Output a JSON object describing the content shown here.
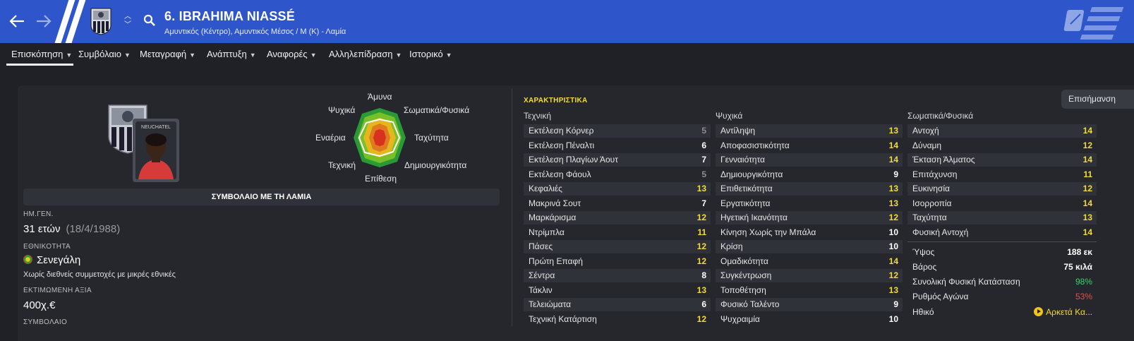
{
  "header": {
    "player_name": "6. IBRAHIMA NIASSÉ",
    "player_subtitle": "Αμυντικός (Κέντρο), Αμυντικός Μέσος / Μ (Κ) - Λαμία"
  },
  "tabs": [
    {
      "label": "Επισκόπηση"
    },
    {
      "label": "Συμβόλαιο"
    },
    {
      "label": "Μεταγραφή"
    },
    {
      "label": "Ανάπτυξη"
    },
    {
      "label": "Αναφορές"
    },
    {
      "label": "Αλληλεπίδραση"
    },
    {
      "label": "Ιστορικό"
    }
  ],
  "card": {
    "kit_text": "NEUCHATEL"
  },
  "radar": {
    "labels": {
      "top": "Άμυνα",
      "top_right": "Σωματικά/Φυσικά",
      "right": "Ταχύτητα",
      "bottom_right": "Δημιουργικότητα",
      "bottom": "Επίθεση",
      "bottom_left": "Τεχνική",
      "left": "Εναέρια",
      "top_left": "Ψυχικά"
    }
  },
  "contract": {
    "title": "ΣΥΜΒΟΛΑΙΟ ΜΕ ΤΗ ΛΑΜΙΑ"
  },
  "profile": {
    "dob_label": "ΗΜ.ΓΕΝ.",
    "age": "31 ετών",
    "dob": "(18/4/1988)",
    "nationality_label": "ΕΘΝΙΚΟΤΗΤΑ",
    "nationality": "Σενεγάλη",
    "caps_note": "Χωρίς διεθνείς συμμετοχές με μικρές εθνικές",
    "value_label": "ΕΚΤΙΜΩΜΕΝΗ ΑΞΙΑ",
    "value": "400χ.€",
    "contract_label": "ΣΥΜΒΟΛΑΙΟ"
  },
  "attributes": {
    "title": "ΧΑΡΑΚΤΗΡΙΣΤΙΚΑ",
    "emphasis_button": "Επισήμανση",
    "technical": {
      "heading": "Τεχνική",
      "rows": [
        {
          "name": "Εκτέλεση Κόρνερ",
          "value": "5"
        },
        {
          "name": "Εκτέλεση Πέναλτι",
          "value": "6"
        },
        {
          "name": "Εκτέλεση Πλαγίων Άουτ",
          "value": "7"
        },
        {
          "name": "Εκτέλεση Φάουλ",
          "value": "5"
        },
        {
          "name": "Κεφαλιές",
          "value": "13"
        },
        {
          "name": "Μακρινά Σουτ",
          "value": "7"
        },
        {
          "name": "Μαρκάρισμα",
          "value": "12"
        },
        {
          "name": "Ντρίμπλα",
          "value": "11"
        },
        {
          "name": "Πάσες",
          "value": "12"
        },
        {
          "name": "Πρώτη Επαφή",
          "value": "12"
        },
        {
          "name": "Σέντρα",
          "value": "8"
        },
        {
          "name": "Τάκλιν",
          "value": "13"
        },
        {
          "name": "Τελειώματα",
          "value": "6"
        },
        {
          "name": "Τεχνική Κατάρτιση",
          "value": "12"
        }
      ]
    },
    "mental": {
      "heading": "Ψυχικά",
      "rows": [
        {
          "name": "Αντίληψη",
          "value": "13"
        },
        {
          "name": "Αποφασιστικότητα",
          "value": "14"
        },
        {
          "name": "Γενναιότητα",
          "value": "14"
        },
        {
          "name": "Δημιουργικότητα",
          "value": "9"
        },
        {
          "name": "Επιθετικότητα",
          "value": "13"
        },
        {
          "name": "Εργατικότητα",
          "value": "13"
        },
        {
          "name": "Ηγετική Ικανότητα",
          "value": "12"
        },
        {
          "name": "Κίνηση Χωρίς την Μπάλα",
          "value": "10"
        },
        {
          "name": "Κρίση",
          "value": "10"
        },
        {
          "name": "Ομαδικότητα",
          "value": "14"
        },
        {
          "name": "Συγκέντρωση",
          "value": "12"
        },
        {
          "name": "Τοποθέτηση",
          "value": "13"
        },
        {
          "name": "Φυσικό Ταλέντο",
          "value": "9"
        },
        {
          "name": "Ψυχραιμία",
          "value": "10"
        }
      ]
    },
    "physical": {
      "heading": "Σωματικά/Φυσικά",
      "rows": [
        {
          "name": "Αντοχή",
          "value": "14"
        },
        {
          "name": "Δύναμη",
          "value": "12"
        },
        {
          "name": "Έκταση Άλματος",
          "value": "14"
        },
        {
          "name": "Επιτάχυνση",
          "value": "11"
        },
        {
          "name": "Ευκινησία",
          "value": "12"
        },
        {
          "name": "Ισορροπία",
          "value": "14"
        },
        {
          "name": "Ταχύτητα",
          "value": "13"
        },
        {
          "name": "Φυσική Αντοχή",
          "value": "14"
        }
      ]
    }
  },
  "stats": {
    "height_label": "Ύψος",
    "height": "188 εκ",
    "weight_label": "Βάρος",
    "weight": "75 κιλά",
    "condition_label": "Συνολική Φυσική Κατάσταση",
    "condition": "98%",
    "sharpness_label": "Ρυθμός Αγώνα",
    "sharpness": "53%",
    "morale_label": "Ηθικό",
    "morale": "Αρκετά Κα..."
  },
  "colors": {
    "header_blue": "#2e55c9",
    "good_green": "#3bd46a",
    "bad_red": "#e0524a",
    "attr_high_yellow": "#f3d93a",
    "attr_mid_white": "#ffffff",
    "attr_low_grey": "#8e8e8e"
  }
}
